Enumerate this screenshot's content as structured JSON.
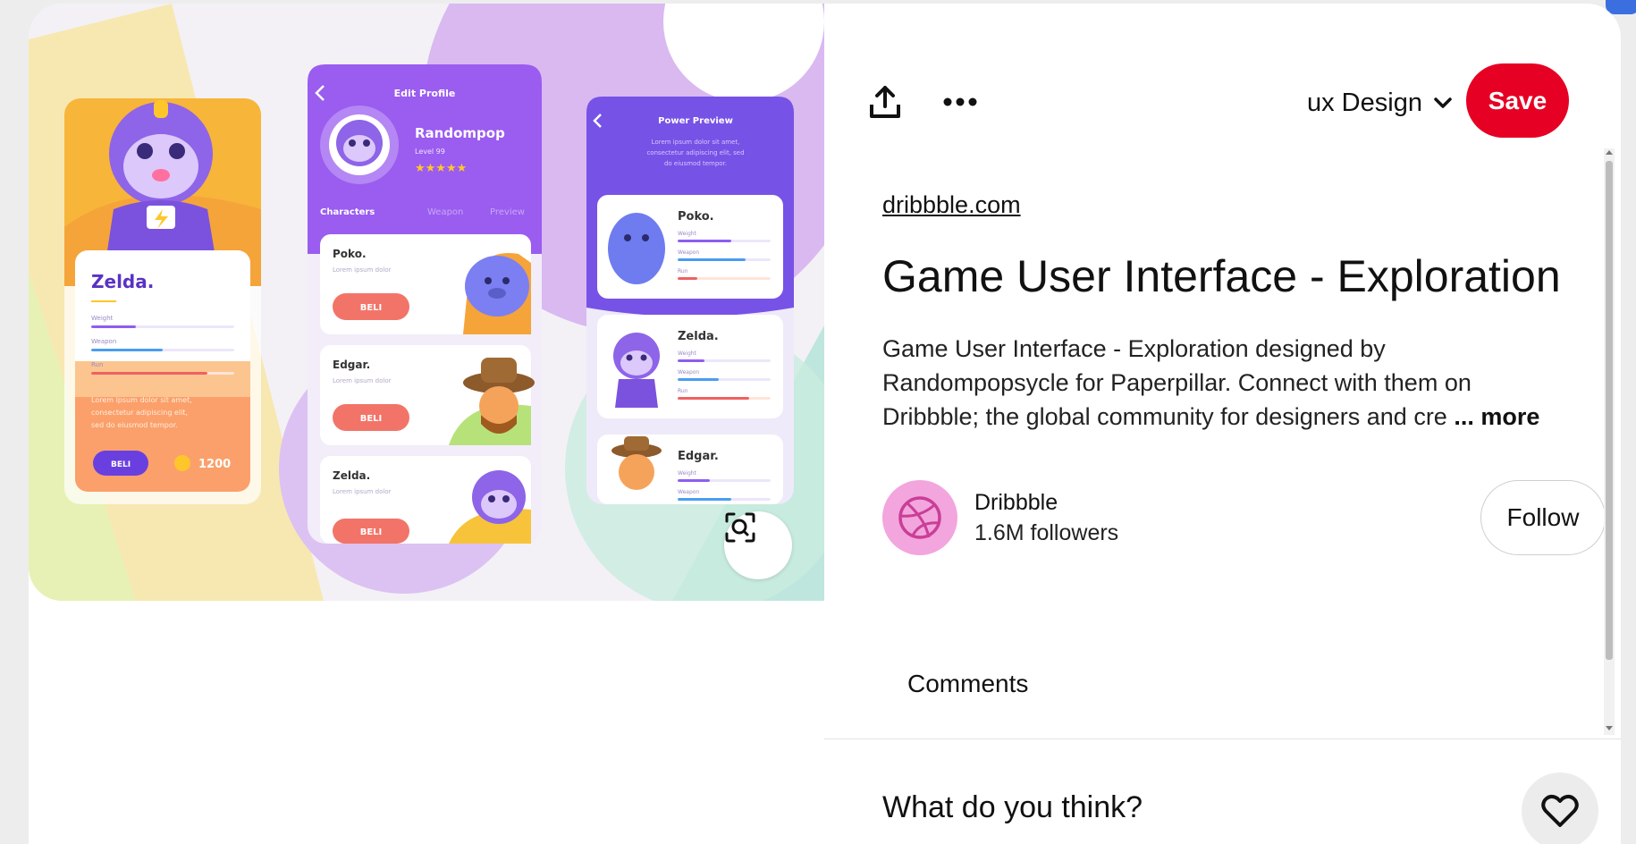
{
  "image": {
    "alt": "Game User Interface - Exploration",
    "screens": {
      "left": {
        "name": "Zelda.",
        "stats": [
          "Weight",
          "Weapon",
          "Run"
        ],
        "lorem": [
          "Lorem ipsum dolor sit amet,",
          "consectetur adipiscing elit,",
          "sed do eiusmod tempor."
        ],
        "buy_label": "BELI",
        "coins": "1200"
      },
      "middle": {
        "header": "Edit Profile",
        "player_name": "Randompop",
        "level": "Level 99",
        "tabs": [
          "Characters",
          "Weapon",
          "Preview"
        ],
        "cards": [
          {
            "name": "Poko.",
            "subtitle": "Lorem ipsum dolor",
            "button": "BELI"
          },
          {
            "name": "Edgar.",
            "subtitle": "Lorem ipsum dolor",
            "button": "BELI"
          },
          {
            "name": "Zelda.",
            "subtitle": "Lorem ipsum dolor",
            "button": "BELI"
          }
        ]
      },
      "right": {
        "header": "Power Preview",
        "intro": [
          "Lorem ipsum dolor sit amet,",
          "consectetur adipiscing elit, sed",
          "do eiusmod tempor."
        ],
        "cards": [
          {
            "name": "Poko."
          },
          {
            "name": "Zelda."
          },
          {
            "name": "Edgar."
          }
        ],
        "stats": [
          "Weight",
          "Weapon",
          "Run"
        ]
      }
    },
    "lens_icon": "visual-search-icon"
  },
  "actions": {
    "share_icon": "share-upload-icon",
    "more_icon": "more-horizontal-icon",
    "board_label": "ux Design",
    "save_label": "Save"
  },
  "pin": {
    "source": "dribbble.com",
    "title": "Game User Interface - Exploration",
    "description_lines": [
      "Game User Interface - Exploration designed by",
      "Randompopsycle for Paperpillar. Connect with them on",
      "Dribbble; the global community for designers and cre"
    ],
    "more_label": "... more"
  },
  "creator": {
    "name": "Dribbble",
    "followers": "1.6M followers",
    "follow_label": "Follow",
    "avatar_icon": "dribbble-logo-icon"
  },
  "comments": {
    "title": "Comments",
    "prompt": "What do you think?",
    "react_icon": "heart-icon"
  },
  "colors": {
    "save": "#e60023",
    "avatar": "#f3a5de",
    "purple": "#8e5cf0",
    "lilac": "#dcc8f3"
  }
}
